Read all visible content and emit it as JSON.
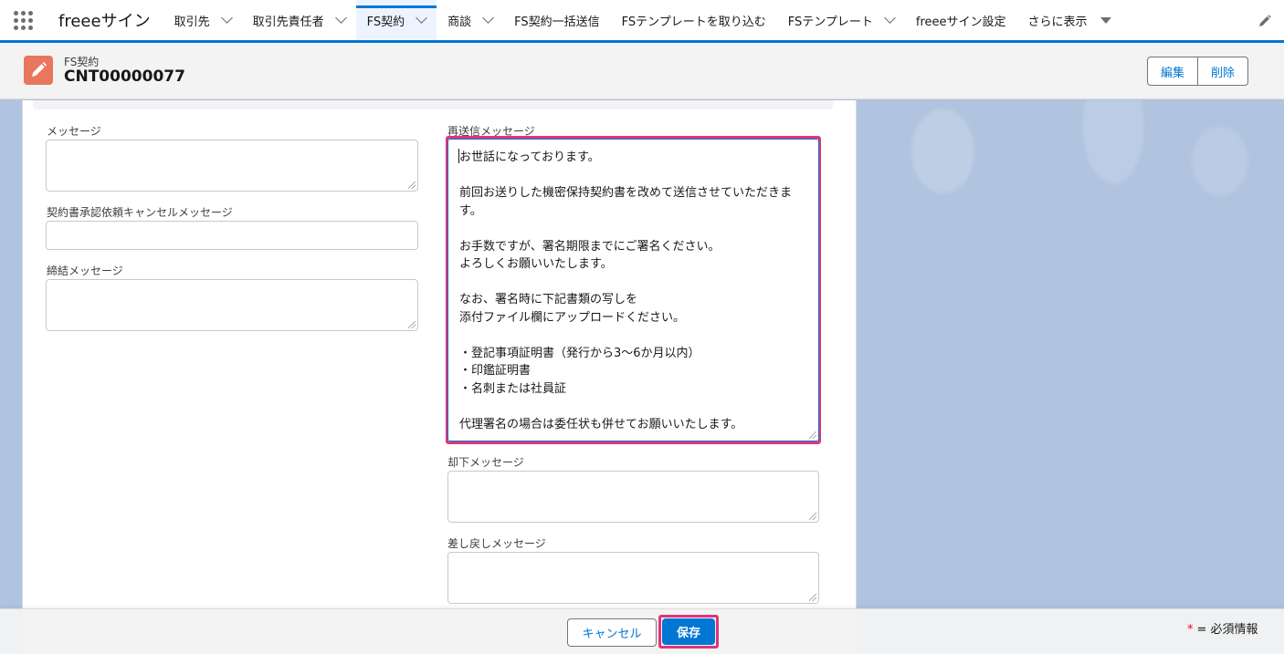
{
  "nav": {
    "app_name": "freeeサイン",
    "tabs": [
      {
        "label": "取引先"
      },
      {
        "label": "取引先責任者"
      },
      {
        "label": "FS契約"
      },
      {
        "label": "商談"
      },
      {
        "label": "FS契約一括送信"
      },
      {
        "label": "FSテンプレートを取り込む"
      },
      {
        "label": "FSテンプレート"
      },
      {
        "label": "freeeサイン設定"
      },
      {
        "label": "さらに表示"
      }
    ]
  },
  "record": {
    "type": "FS契約",
    "title": "CNT00000077",
    "edit_label": "編集",
    "delete_label": "削除"
  },
  "form": {
    "message_label": "メッセージ",
    "cancel_message_label": "契約書承認依頼キャンセルメッセージ",
    "conclusion_message_label": "締結メッセージ",
    "resend_label": "再送信メッセージ",
    "resend_lines": [
      "お世話になっております。",
      "",
      "前回お送りした機密保持契約書を改めて送信させていただきま",
      "す。",
      "",
      "お手数ですが、署名期限までにご署名ください。",
      "よろしくお願いいたします。",
      "",
      "なお、署名時に下記書類の写しを",
      "添付ファイル欄にアップロードください。",
      "",
      "・登記事項証明書（発行から3〜6か月以内）",
      "・印鑑証明書",
      "・名刺または社員証",
      "",
      "代理署名の場合は委任状も併せてお願いいたします。"
    ],
    "reject_label": "却下メッセージ",
    "sendback_label": "差し戻しメッセージ"
  },
  "footer": {
    "cancel_label": "キャンセル",
    "save_label": "保存",
    "required_star": "*",
    "required_text": "= 必須情報"
  },
  "colors": {
    "brand": "#0176d3",
    "highlight": "#e3337a",
    "record_icon": "#e9775e"
  }
}
